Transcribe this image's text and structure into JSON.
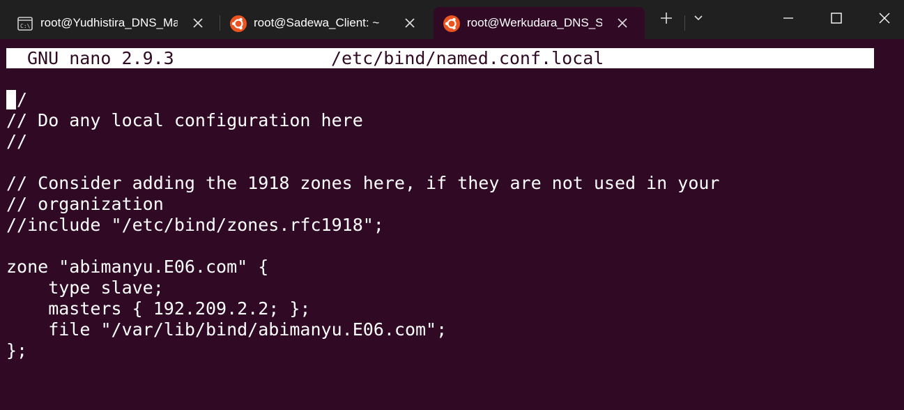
{
  "window": {
    "tabs": [
      {
        "label": "root@Yudhistira_DNS_Master: ~",
        "icon": "cmd-icon",
        "active": false
      },
      {
        "label": "root@Sadewa_Client: ~",
        "icon": "ubuntu-icon",
        "active": false
      },
      {
        "label": "root@Werkudara_DNS_Slave: ~",
        "icon": "ubuntu-icon",
        "active": true
      }
    ],
    "new_tab_icon": "plus-icon",
    "dropdown_icon": "chevron-down-icon",
    "controls": [
      "minimize-icon",
      "maximize-icon",
      "close-icon"
    ],
    "colors": {
      "titlebar": "#202020",
      "terminal_bg": "#300a24",
      "ubuntu_orange": "#e95420"
    }
  },
  "nano": {
    "version": "GNU nano 2.9.3",
    "filename": "/etc/bind/named.conf.local"
  },
  "editor": {
    "lines": [
      "//",
      "// Do any local configuration here",
      "//",
      "",
      "// Consider adding the 1918 zones here, if they are not used in your",
      "// organization",
      "//include \"/etc/bind/zones.rfc1918\";",
      "",
      "zone \"abimanyu.E06.com\" {",
      "    type slave;",
      "    masters { 192.209.2.2; };",
      "    file \"/var/lib/bind/abimanyu.E06.com\";",
      "};"
    ],
    "cursor": {
      "line": 1,
      "column": 1
    }
  }
}
